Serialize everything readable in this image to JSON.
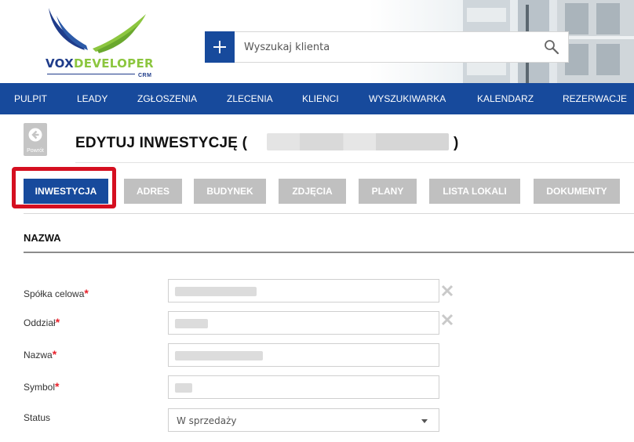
{
  "header": {
    "logo": {
      "part1": "VOX",
      "part2": "DEVELOPER",
      "sub": "CRM"
    },
    "search": {
      "placeholder": "Wyszukaj klienta"
    }
  },
  "nav": {
    "items": [
      "PULPIT",
      "LEADY",
      "ZGŁOSZENIA",
      "ZLECENIA",
      "KLIENCI",
      "WYSZUKIWARKA",
      "KALENDARZ",
      "REZERWACJE"
    ]
  },
  "page": {
    "back_label": "Powrót",
    "title": "EDYTUJ INWESTYCJĘ (",
    "title_close": ")"
  },
  "tabs": [
    "INWESTYCJA",
    "ADRES",
    "BUDYNEK",
    "ZDJĘCIA",
    "PLANY",
    "LISTA LOKALI",
    "DOKUMENTY"
  ],
  "active_tab": "INWESTYCJA",
  "section": {
    "title": "NAZWA"
  },
  "form": {
    "required_mark": "*",
    "fields": [
      {
        "label": "Spółka celowa",
        "required": true
      },
      {
        "label": "Oddział",
        "required": true
      },
      {
        "label": "Nazwa",
        "required": true
      },
      {
        "label": "Symbol",
        "required": true
      },
      {
        "label": "Status",
        "required": false,
        "value": "W sprzedaży"
      }
    ]
  },
  "colors": {
    "brand": "#174a9c",
    "accent_green": "#8cc63f",
    "highlight": "#d50f20",
    "required": "#e8202a",
    "tab_inactive": "#c0c0c0"
  }
}
